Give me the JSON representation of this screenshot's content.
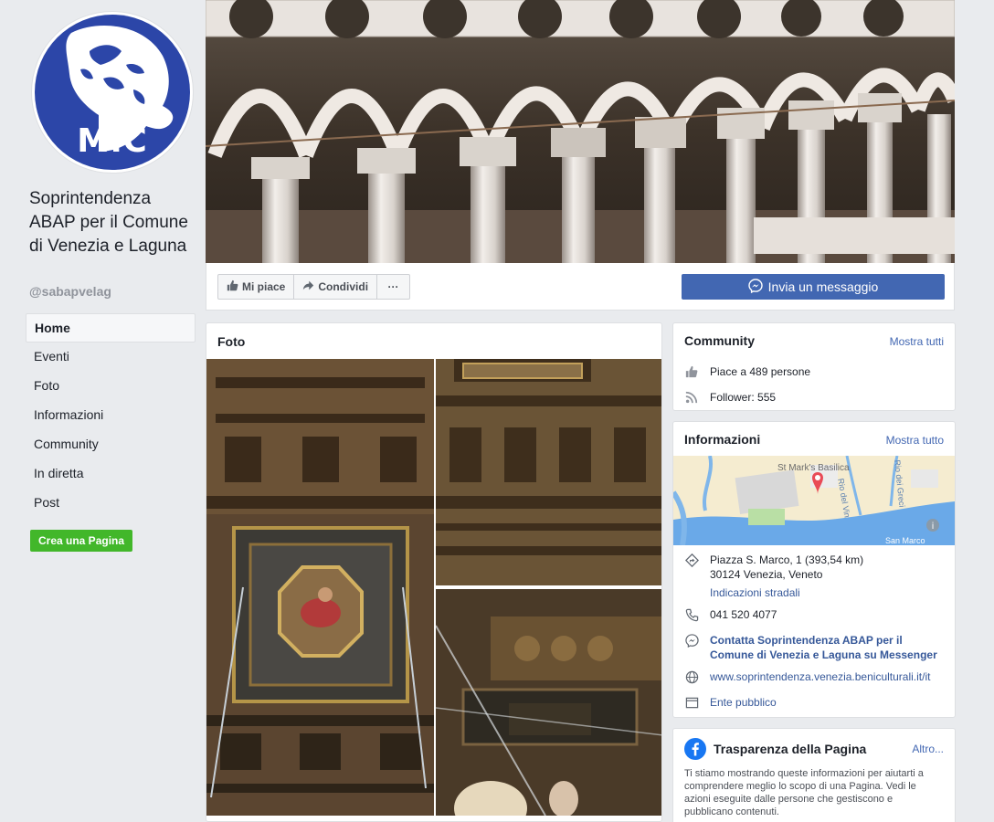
{
  "page": {
    "name": "Soprintendenza ABAP per il Comune di Venezia e Laguna",
    "handle": "@sabapvelag",
    "logo_text": "MiC"
  },
  "nav": {
    "items": [
      {
        "label": "Home",
        "active": true
      },
      {
        "label": "Eventi"
      },
      {
        "label": "Foto"
      },
      {
        "label": "Informazioni"
      },
      {
        "label": "Community"
      },
      {
        "label": "In diretta"
      },
      {
        "label": "Post"
      }
    ],
    "create_page": "Crea una Pagina"
  },
  "actions": {
    "like": "Mi piace",
    "share": "Condividi",
    "more": "···",
    "message": "Invia un messaggio"
  },
  "photos": {
    "title": "Foto"
  },
  "community": {
    "title": "Community",
    "see_all": "Mostra tutti",
    "likes": "Piace a 489 persone",
    "followers": "Follower: 555"
  },
  "info": {
    "title": "Informazioni",
    "see_all": "Mostra tutto",
    "map_labels": {
      "place": "St Mark's Basilica",
      "canal1": "Rio del Vin",
      "canal2": "Rio dei Greci",
      "water": "San Marco"
    },
    "address_line1": "Piazza S. Marco, 1 (393,54 km)",
    "address_line2": "30124 Venezia, Veneto",
    "directions": "Indicazioni stradali",
    "phone": "041 520 4077",
    "messenger": "Contatta Soprintendenza ABAP per il Comune di Venezia e Laguna su Messenger",
    "website": "www.soprintendenza.venezia.beniculturali.it/it",
    "category": "Ente pubblico"
  },
  "transparency": {
    "title": "Trasparenza della Pagina",
    "more": "Altro...",
    "text": "Ti stiamo mostrando queste informazioni per aiutarti a comprendere meglio lo scopo di una Pagina. Vedi le azioni eseguite dalle persone che gestiscono e pubblicano contenuti."
  },
  "colors": {
    "brand_blue": "#4267b2",
    "link": "#365899",
    "green": "#42b72a",
    "logo_blue": "#2c46a8",
    "background": "#e9ebee"
  }
}
